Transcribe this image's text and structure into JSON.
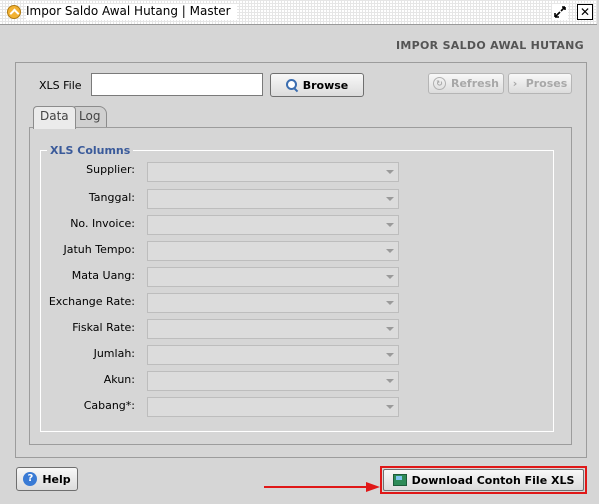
{
  "window": {
    "title": "Impor Saldo Awal Hutang | Master",
    "restore_label": "⤡",
    "close_label": "✕"
  },
  "heading": "IMPOR SALDO AWAL HUTANG",
  "file": {
    "label": "XLS File",
    "value": "",
    "browse_label": "Browse"
  },
  "toolbar": {
    "refresh_label": "Refresh",
    "proses_label": "Proses"
  },
  "tabs": [
    {
      "label": "Data",
      "active": true
    },
    {
      "label": "Log",
      "active": false
    }
  ],
  "xls_columns": {
    "legend": "XLS Columns",
    "fields": [
      {
        "label": "Supplier:",
        "value": ""
      },
      {
        "label": "Tanggal:",
        "value": ""
      },
      {
        "label": "No. Invoice:",
        "value": ""
      },
      {
        "label": "Jatuh Tempo:",
        "value": ""
      },
      {
        "label": "Mata Uang:",
        "value": ""
      },
      {
        "label": "Exchange Rate:",
        "value": ""
      },
      {
        "label": "Fiskal Rate:",
        "value": ""
      },
      {
        "label": "Jumlah:",
        "value": ""
      },
      {
        "label": "Akun:",
        "value": ""
      },
      {
        "label": "Cabang*:",
        "value": ""
      }
    ]
  },
  "footer": {
    "help_label": "Help",
    "help_icon": "?",
    "download_label": "Download Contoh File XLS"
  },
  "colors": {
    "highlight": "#e01818",
    "legend": "#3a5a9a"
  }
}
